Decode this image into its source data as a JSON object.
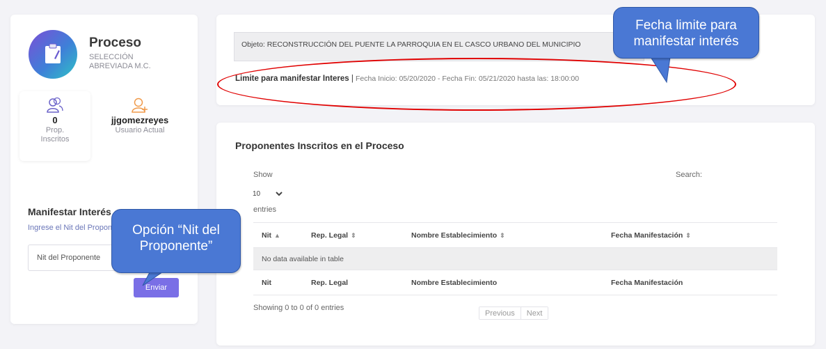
{
  "process": {
    "title": "Proceso",
    "subtitle": "SELECCIÓN ABREVIADA M.C."
  },
  "stats": {
    "proponents_count": "0",
    "proponents_label": "Prop. Inscritos",
    "user_name": "jjgomezreyes",
    "user_label": "Usuario Actual"
  },
  "manifest": {
    "title": "Manifestar Interés",
    "help": "Ingrese el Nit del Proponente",
    "input_placeholder": "Nit del Proponente",
    "send_label": "Enviar"
  },
  "objeto": {
    "text": "Objeto: RECONSTRUCCIÓN DEL PUENTE LA PARROQUIA EN EL CASCO URBANO DEL MUNICIPIO"
  },
  "limit": {
    "label": "Limite para manifestar Interes",
    "separator": " | ",
    "dates": "Fecha Inicio: 05/20/2020 - Fecha Fin: 05/21/2020 hasta las: 18:00:00"
  },
  "table_section": {
    "title": "Proponentes Inscritos en el Proceso",
    "show_label": "Show",
    "page_length": "10",
    "entries_label": "entries",
    "search_label": "Search:",
    "columns": [
      "Nit",
      "Rep. Legal",
      "Nombre Establecimiento",
      "Fecha Manifestación"
    ],
    "empty_message": "No data available in table",
    "info": "Showing 0 to 0 of 0 entries",
    "prev_label": "Previous",
    "next_label": "Next"
  },
  "annotations": {
    "fecha_callout": "Fecha limite para manifestar interés",
    "nit_callout": "Opción “Nit del Proponente”"
  },
  "colors": {
    "accent": "#7a6fe6",
    "callout_fill": "#4a78d4",
    "highlight": "#e00000"
  }
}
